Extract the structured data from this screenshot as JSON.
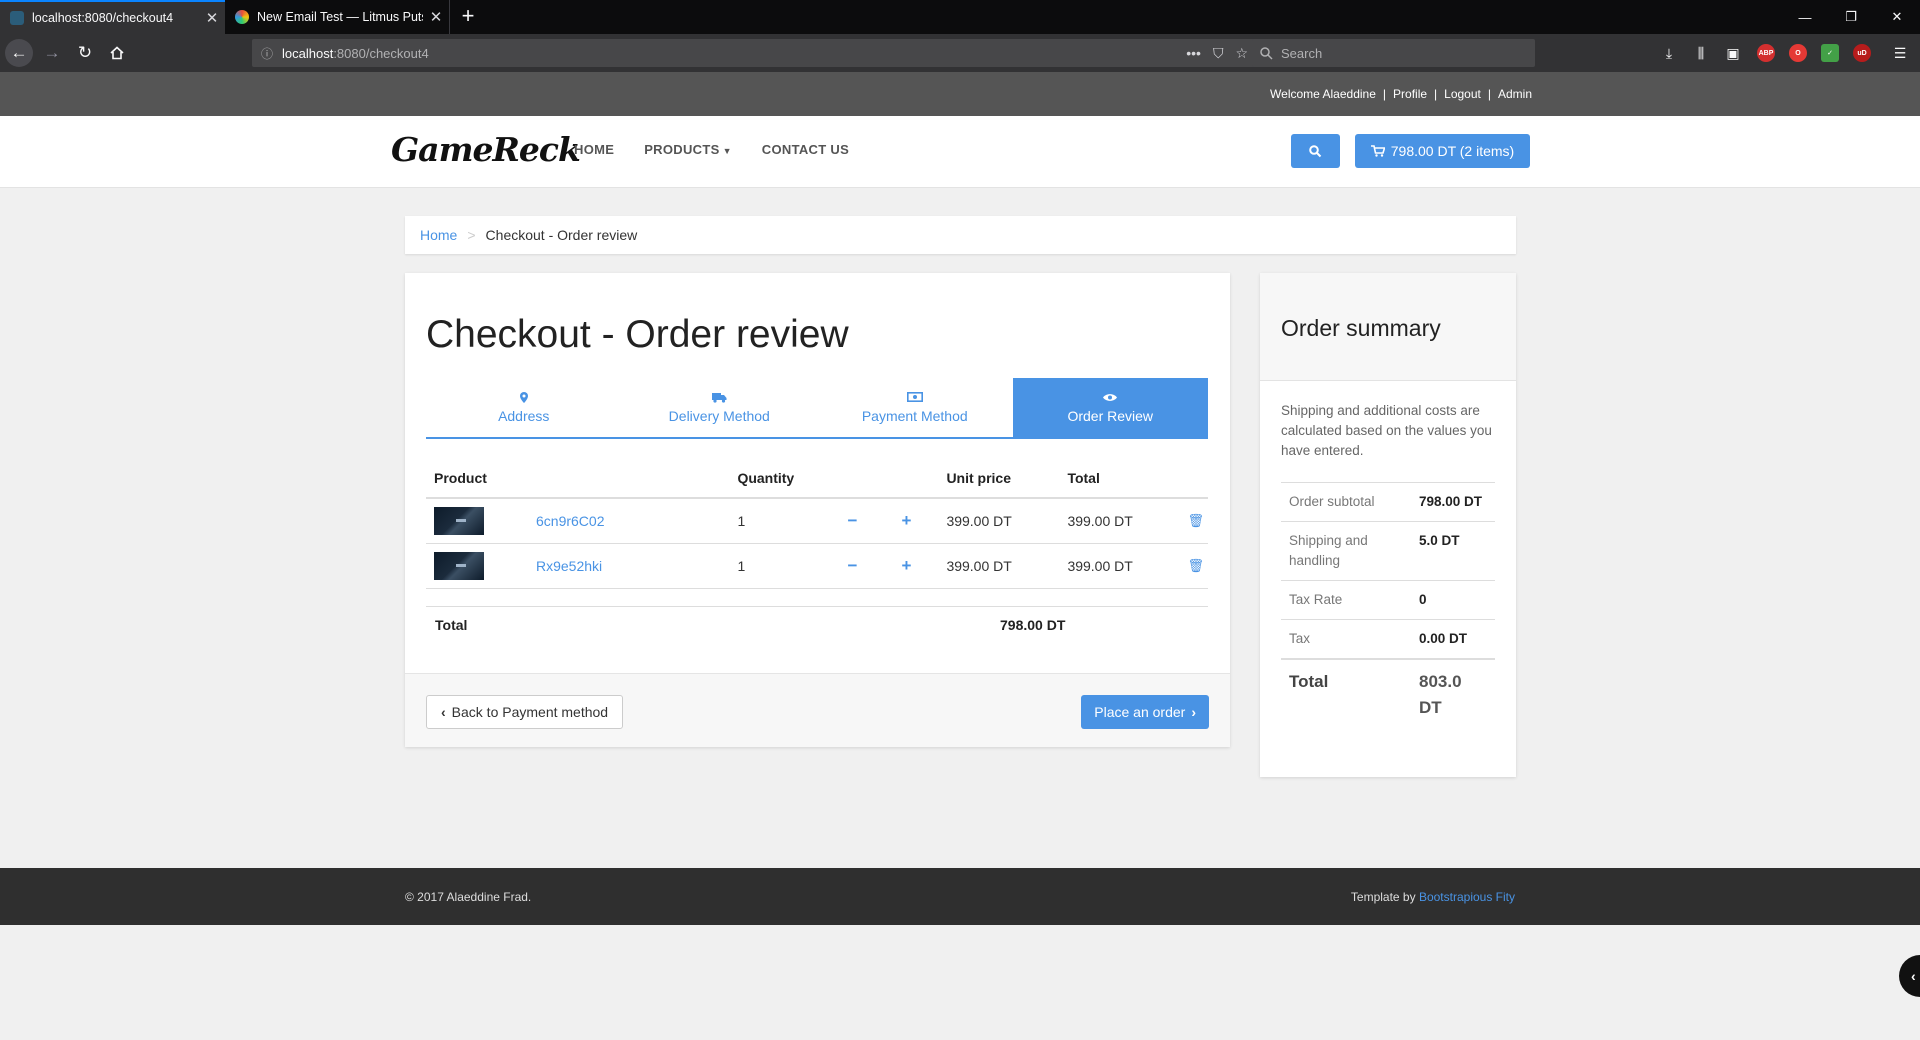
{
  "browser": {
    "tabs": [
      {
        "title": "localhost:8080/checkout4"
      },
      {
        "title": "New Email Test — Litmus Putsi"
      }
    ],
    "new_tab": "+",
    "url_host": "localhost",
    "url_path": ":8080/checkout4",
    "search_placeholder": "Search",
    "window_controls": [
      "—",
      "❐",
      "✕"
    ]
  },
  "site": {
    "topbar": {
      "welcome": "Welcome Alaeddine",
      "profile": "Profile",
      "logout": "Logout",
      "admin": "Admin",
      "separator": "|"
    },
    "logo": "GameReck",
    "nav": {
      "home": "HOME",
      "products": "PRODUCTS",
      "contact": "CONTACT US"
    },
    "cart_button": "798.00 DT (2 items)",
    "breadcrumb": {
      "home": "Home",
      "separator": ">",
      "current": "Checkout - Order review"
    },
    "checkout": {
      "title": "Checkout - Order review",
      "steps": [
        {
          "label": "Address",
          "icon": "map-marker-icon"
        },
        {
          "label": "Delivery Method",
          "icon": "truck-icon"
        },
        {
          "label": "Payment Method",
          "icon": "money-icon"
        },
        {
          "label": "Order Review",
          "icon": "eye-icon"
        }
      ],
      "table": {
        "headers": {
          "product": "Product",
          "quantity": "Quantity",
          "unit_price": "Unit price",
          "total": "Total"
        },
        "rows": [
          {
            "name": "6cn9r6C02",
            "quantity": "1",
            "unit_price": "399.00 DT",
            "total": "399.00 DT"
          },
          {
            "name": "Rx9e52hki",
            "quantity": "1",
            "unit_price": "399.00 DT",
            "total": "399.00 DT"
          }
        ],
        "minus": "−",
        "plus": "+"
      },
      "total_label": "Total",
      "total_value": "798.00 DT",
      "back_button": "Back to Payment method",
      "order_button": "Place an order"
    },
    "summary": {
      "title": "Order summary",
      "note": "Shipping and additional costs are calculated based on the values you have entered.",
      "rows": [
        {
          "label": "Order subtotal",
          "value": "798.00 DT"
        },
        {
          "label": "Shipping and handling",
          "value": "5.0 DT"
        },
        {
          "label": "Tax Rate",
          "value": "0"
        },
        {
          "label": "Tax",
          "value": "0.00 DT"
        }
      ],
      "total_label": "Total",
      "total_value": "803.0 DT"
    },
    "footer": {
      "copyright": "© 2017 Alaeddine Frad.",
      "template_by": "Template by ",
      "template_link": "Bootstrapious Fity"
    }
  },
  "colors": {
    "accent": "#4993e4",
    "footer": "#2f2f2f",
    "topstrip": "#555555"
  }
}
